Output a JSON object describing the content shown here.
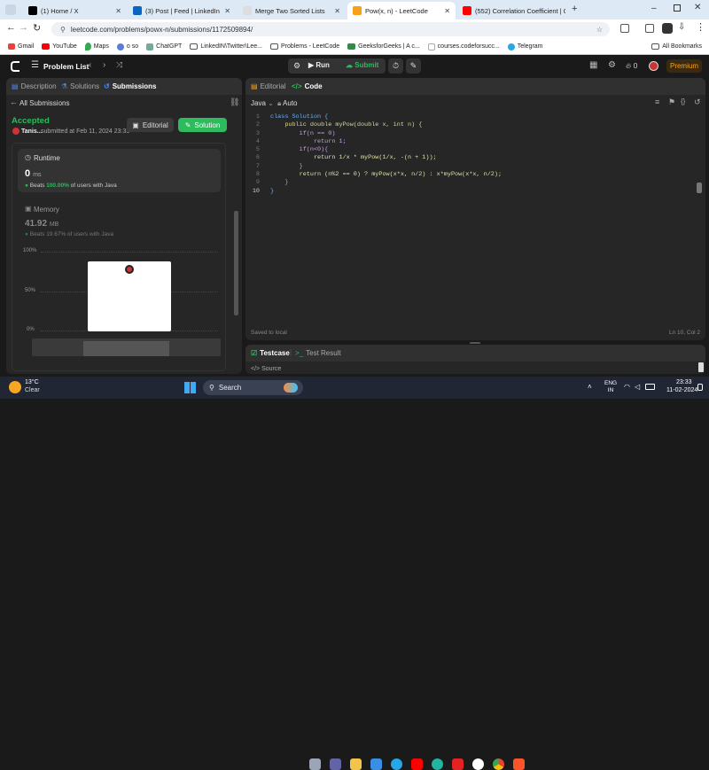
{
  "tabs": [
    {
      "title": "(1) Home / X",
      "color": "#000000"
    },
    {
      "title": "(3) Post | Feed | LinkedIn",
      "color": "#0a66c2"
    },
    {
      "title": "Merge Two Sorted Lists",
      "color": "#cccccc"
    },
    {
      "title": "Pow(x, n) - LeetCode",
      "color": "#f7a11a"
    },
    {
      "title": "(552) Correlation Coefficient | C",
      "color": "#ff0000"
    }
  ],
  "url": "leetcode.com/problems/powx-n/submissions/1172509894/",
  "bookmarks": [
    "Gmail",
    "YouTube",
    "Maps",
    "o so",
    "ChatGPT",
    "LinkedIN\\Twitter\\Lee...",
    "Problems - LeetCode",
    "GeeksforGeeks | A c...",
    "courses.codeforsucc...",
    "Telegram"
  ],
  "all_bookmarks": "All Bookmarks",
  "lc": {
    "problem_list": "Problem List",
    "run": "Run",
    "submit": "Submit",
    "streak": "0",
    "premium": "Premium"
  },
  "left_tabs": [
    "Description",
    "Solutions",
    "Submissions"
  ],
  "all_submissions": "All Submissions",
  "status": "Accepted",
  "user": "Tanis...",
  "submitted": "submitted at Feb 11, 2024 23:33",
  "editorial_btn": "Editorial",
  "solution_btn": "Solution",
  "runtime": {
    "label": "Runtime",
    "value": "0",
    "unit": "ms",
    "beats_prefix": "Beats",
    "beats_pct": "100.00%",
    "beats_suffix": "of users with Java"
  },
  "memory": {
    "label": "Memory",
    "value": "41.92",
    "unit": "MB",
    "beats_prefix": "Beats",
    "beats_pct": "19.67%",
    "beats_suffix": "of users with Java"
  },
  "chart_axis": [
    "100%",
    "50%",
    "0%"
  ],
  "right_tabs": {
    "editorial": "Editorial",
    "code": "Code"
  },
  "lang": "Java",
  "auto": "Auto",
  "code_lines": [
    "class Solution {",
    "    public double myPow(double x, int n) {",
    "        if(n == 0)",
    "            return 1;",
    "        if(n<0){",
    "            return 1/x * myPow(1/x, -(n + 1));",
    "        }",
    "        return (n%2 == 0) ? myPow(x*x, n/2) : x*myPow(x*x, n/2);",
    "    }",
    "}"
  ],
  "saved": "Saved to local",
  "cursor": "Ln 10, Col 2",
  "testcase": "Testcase",
  "test_result": "Test Result",
  "source": "Source",
  "weather": {
    "temp": "13°C",
    "cond": "Clear"
  },
  "search": "Search",
  "lang_ind": {
    "l1": "ENG",
    "l2": "IN"
  },
  "clock": {
    "time": "23:33",
    "date": "11-02-2024"
  },
  "colors": {
    "accent": "#2cbb5d",
    "accepted": "#2cbb5d",
    "premium": "#ffa116"
  }
}
